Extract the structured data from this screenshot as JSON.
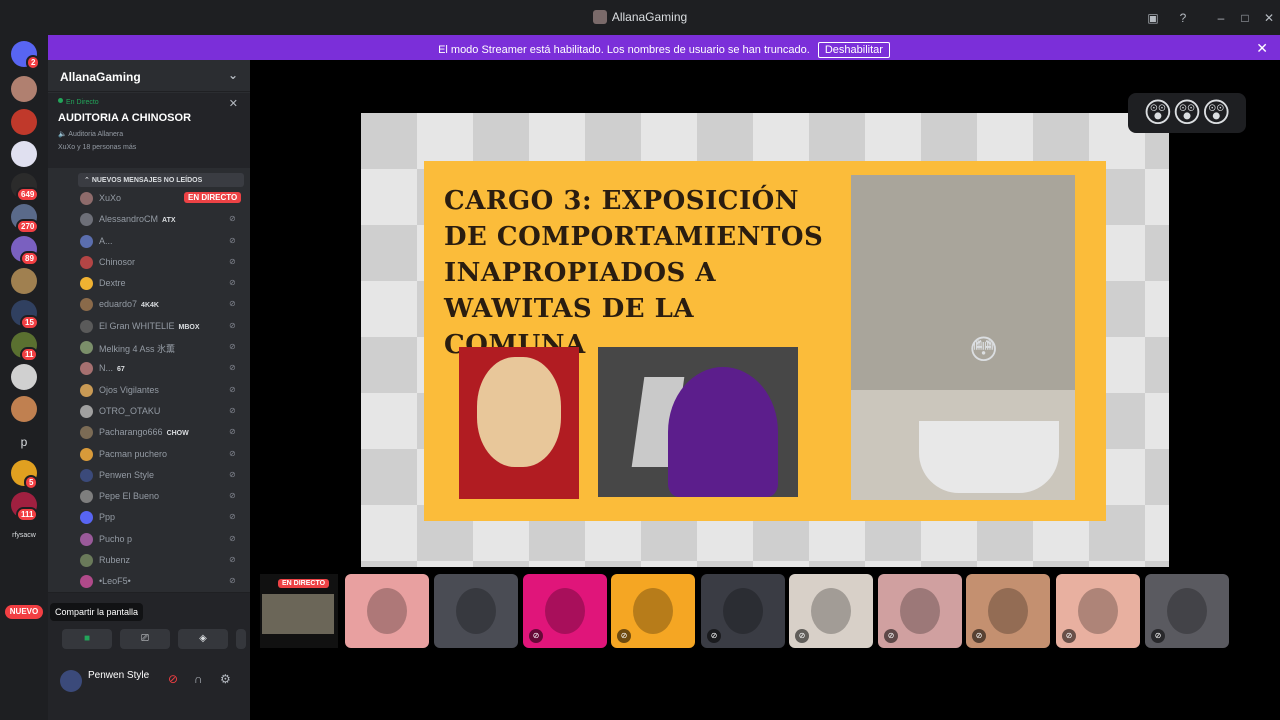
{
  "window": {
    "title": "AllanaGaming"
  },
  "banner": {
    "message": "El modo Streamer está habilitado. Los nombres de usuario se han truncado.",
    "button": "Deshabilitar"
  },
  "rail": {
    "badges": [
      "2",
      "649",
      "270",
      "89",
      "15",
      "11",
      "5",
      "111"
    ],
    "letters": [
      "p",
      "rfysacw"
    ],
    "nuevo": "NUEVO"
  },
  "sidebar": {
    "server_name": "AllanaGaming",
    "live": {
      "status": "En Directo",
      "channel": "AUDITORIA A CHINOSOR",
      "voice_channel": "Auditoria Allanera",
      "people": "XuXo y 18 personas más"
    },
    "new_messages": "NUEVOS MENSAJES NO LEÍDOS",
    "members": [
      {
        "name": "XuXo",
        "live": "EN DIRECTO",
        "color": "#8e6b6b"
      },
      {
        "name": "AlessandroCM",
        "tag": "ATX",
        "color": "#6d6f78"
      },
      {
        "name": "A...",
        "color": "#5b6eae"
      },
      {
        "name": "Chinosor",
        "color": "#b34545"
      },
      {
        "name": "Dextre",
        "color": "#f0b232"
      },
      {
        "name": "eduardo7",
        "tag": "4K4K",
        "color": "#8a6a4a"
      },
      {
        "name": "El Gran WHITELIE",
        "tag": "MBOX",
        "color": "#5a5a5a"
      },
      {
        "name": "Melking 4 Ass 氷薫",
        "color": "#7b8f6a"
      },
      {
        "name": "N...",
        "tag": "67",
        "color": "#a67070"
      },
      {
        "name": "Ojos Vigilantes",
        "color": "#c99a55"
      },
      {
        "name": "OTRO_OTAKU",
        "color": "#a0a0a0"
      },
      {
        "name": "Pacharango666",
        "tag": "CHOW",
        "color": "#7b6b55"
      },
      {
        "name": "Pacman puchero",
        "color": "#d89a3a"
      },
      {
        "name": "Penwen Style",
        "color": "#3b4a7a"
      },
      {
        "name": "Pepe El Bueno",
        "color": "#7e7e7e"
      },
      {
        "name": "Ppp",
        "color": "#5865f2"
      },
      {
        "name": "Pucho p",
        "color": "#9a5a9a"
      },
      {
        "name": "Rubenz",
        "color": "#6a7a5a"
      },
      {
        "name": "•LeoF5•",
        "color": "#b04a8a"
      }
    ],
    "tooltip": "Compartir la pantalla",
    "username": "Penwen Style"
  },
  "stage": {
    "slide_title": "CARGO 3: EXPOSICIÓN DE COMPORTAMIENTOS INAPROPIADOS A WAWITAS DE LA COMUNA",
    "reactions": "😲😲😲",
    "live_tile_label": "EN DIRECTO",
    "tile_colors": [
      "#e8a0a0",
      "#4a4c54",
      "#e0157a",
      "#f5a623",
      "#3a3c44",
      "#d8d0c8",
      "#d0a0a0",
      "#c49070",
      "#e8b0a0",
      "#5a5a60"
    ]
  }
}
